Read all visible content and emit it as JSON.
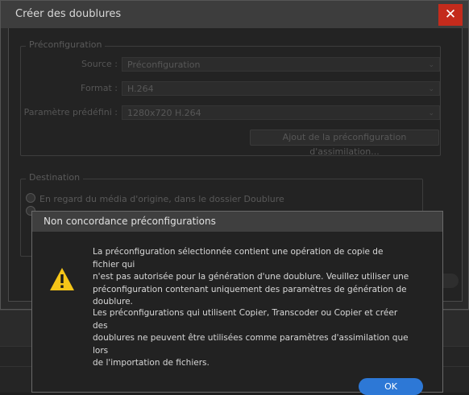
{
  "outer_dialog": {
    "title": "Créer des doublures",
    "close_glyph": "✕",
    "preset_group": {
      "legend": "Préconfiguration",
      "source": {
        "label": "Source :",
        "value": "Préconfiguration"
      },
      "format": {
        "label": "Format :",
        "value": "H.264"
      },
      "preset": {
        "label": "Paramètre prédéfini :",
        "value": "1280x720 H.264"
      },
      "add_ingest_preset": "Ajout de la préconfiguration d'assimilation..."
    },
    "destination_group": {
      "legend": "Destination",
      "option_next_to_media": "En regard du média d'origine, dans le dossier Doublure"
    }
  },
  "modal": {
    "title": "Non concordance préconfigurations",
    "icon": "warning-icon",
    "paragraph1_lines": [
      "La préconfiguration sélectionnée contient une opération de copie de fichier qui",
      "n'est pas autorisée pour la génération d'une doublure. Veuillez utiliser une",
      "préconfiguration contenant uniquement des paramètres de génération de",
      "doublure."
    ],
    "paragraph2_lines": [
      "Les préconfigurations qui utilisent Copier, Transcoder ou Copier et créer des",
      "doublures ne peuvent être utilisées comme paramètres d'assimilation que lors",
      "de l'importation de fichiers."
    ],
    "ok_label": "OK"
  },
  "colors": {
    "accent": "#2d78d6",
    "close": "#c42b1c",
    "warning": "#f5c518"
  }
}
